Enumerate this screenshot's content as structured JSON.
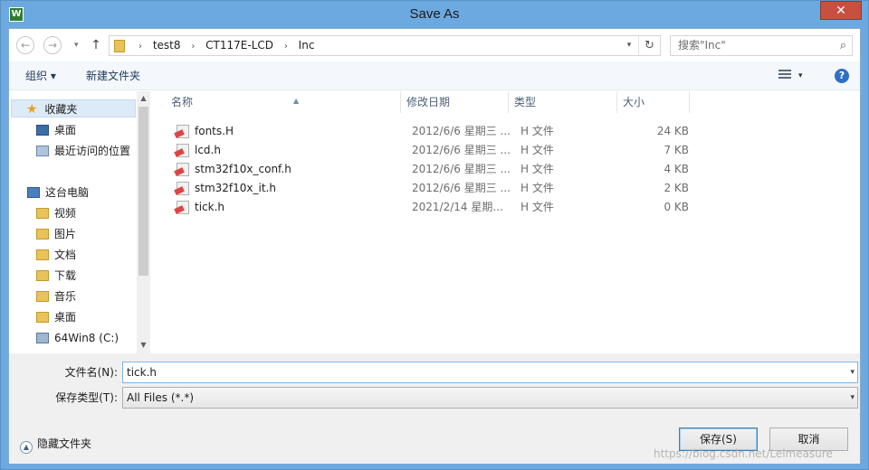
{
  "window": {
    "title": "Save As",
    "close_label": "✕",
    "app_icon_label": "W"
  },
  "nav": {
    "back_icon": "←",
    "forward_icon": "→",
    "history_icon": "▾",
    "up_icon": "↑"
  },
  "address": {
    "crumbs": [
      "test8",
      "CT117E-LCD",
      "Inc"
    ],
    "separator": "›",
    "dropdown_icon": "▾",
    "refresh_icon": "↻"
  },
  "search": {
    "placeholder": "搜索\"Inc\"",
    "icon": "⌕"
  },
  "toolbar": {
    "organize_label": "组织 ▾",
    "new_folder_label": "新建文件夹",
    "view_dropdown": "▾",
    "help_label": "?"
  },
  "sidebar": {
    "items": [
      {
        "label": "收藏夹",
        "icon": "★"
      },
      {
        "label": "桌面"
      },
      {
        "label": "最近访问的位置"
      },
      {
        "label": "这台电脑"
      },
      {
        "label": "视频"
      },
      {
        "label": "图片"
      },
      {
        "label": "文档"
      },
      {
        "label": "下载"
      },
      {
        "label": "音乐"
      },
      {
        "label": "桌面"
      },
      {
        "label": "64Win8  (C:)"
      }
    ],
    "scroll_up": "▲",
    "scroll_down": "▼"
  },
  "columns": {
    "name": "名称",
    "date": "修改日期",
    "type": "类型",
    "size": "大小",
    "sort_icon": "▲"
  },
  "files": [
    {
      "name": "fonts.H",
      "date": "2012/6/6 星期三 ...",
      "type": "H 文件",
      "size": "24 KB"
    },
    {
      "name": "lcd.h",
      "date": "2012/6/6 星期三 ...",
      "type": "H 文件",
      "size": "7 KB"
    },
    {
      "name": "stm32f10x_conf.h",
      "date": "2012/6/6 星期三 ...",
      "type": "H 文件",
      "size": "4 KB"
    },
    {
      "name": "stm32f10x_it.h",
      "date": "2012/6/6 星期三 ...",
      "type": "H 文件",
      "size": "2 KB"
    },
    {
      "name": "tick.h",
      "date": "2021/2/14 星期...",
      "type": "H 文件",
      "size": "0 KB"
    }
  ],
  "form": {
    "filename_label": "文件名(N):",
    "filename_value": "tick.h",
    "filetype_label": "保存类型(T):",
    "filetype_value": "All Files (*.*)",
    "dropdown_icon": "▾"
  },
  "footer": {
    "hide_folders_label": "隐藏文件夹",
    "hide_folders_icon": "▲",
    "save_label": "保存(S)",
    "cancel_label": "取消",
    "watermark": "https://blog.csdn.net/Leimeasure"
  }
}
